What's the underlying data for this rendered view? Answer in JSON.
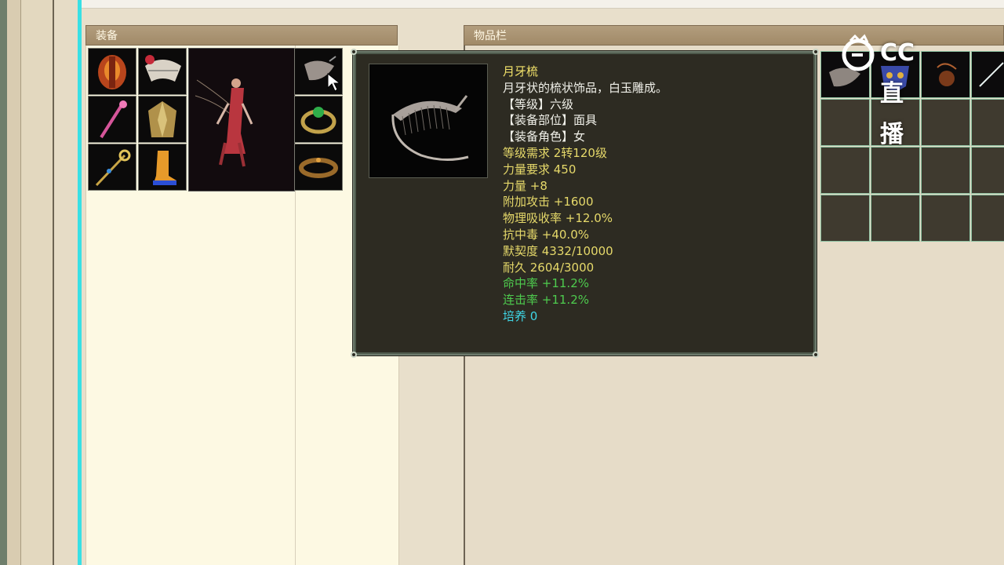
{
  "equipment_panel": {
    "title": "装备"
  },
  "inventory_panel": {
    "title": "物品栏"
  },
  "watermark": {
    "text": "CC直播"
  },
  "tooltip": {
    "lines": [
      {
        "text": "月牙梳",
        "color": "#f2e26a"
      },
      {
        "text": "月牙状的梳状饰品，白玉雕成。",
        "color": "#f1f1ea"
      },
      {
        "text": "【等级】六级",
        "color": "#f1f1ea"
      },
      {
        "text": "【装备部位】面具",
        "color": "#f1f1ea"
      },
      {
        "text": "【装备角色】女",
        "color": "#f1f1ea"
      },
      {
        "text": "等级需求 2转120级",
        "color": "#e6d96a"
      },
      {
        "text": "力量要求 450",
        "color": "#e6d96a"
      },
      {
        "text": "力量 +8",
        "color": "#e6d96a"
      },
      {
        "text": "附加攻击 +1600",
        "color": "#e6d96a"
      },
      {
        "text": "物理吸收率 +12.0%",
        "color": "#e6d96a"
      },
      {
        "text": "抗中毒 +40.0%",
        "color": "#e6d96a"
      },
      {
        "text": "默契度 4332/10000",
        "color": "#e6d96a"
      },
      {
        "text": "耐久 2604/3000",
        "color": "#e6d96a"
      },
      {
        "text": "命中率 +11.2%",
        "color": "#4ecb4e"
      },
      {
        "text": "连击率 +11.2%",
        "color": "#4ecb4e"
      },
      {
        "text": "培养 0",
        "color": "#3fd6e6"
      }
    ]
  },
  "equip_slots": [
    {
      "icon": "armor-icon"
    },
    {
      "icon": "fan-icon"
    },
    {
      "icon": "staff-icon"
    },
    {
      "icon": "robe-icon"
    },
    {
      "icon": "scepter-icon"
    },
    {
      "icon": "boots-icon"
    },
    {
      "icon": "comb-icon"
    },
    {
      "icon": "ring-icon"
    },
    {
      "icon": "bracelet-icon"
    }
  ],
  "inventory_items": [
    {
      "icon": "comb-icon"
    },
    {
      "icon": "mask-icon"
    },
    {
      "icon": "pouch-icon"
    },
    {
      "icon": "shard-icon"
    }
  ]
}
